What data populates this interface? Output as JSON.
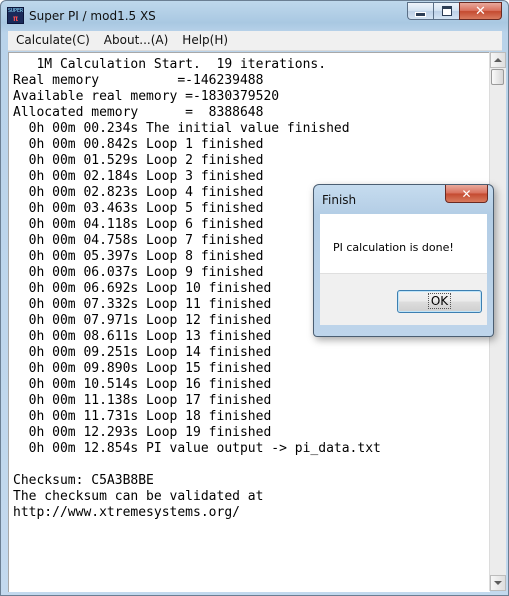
{
  "window": {
    "title": "Super PI / mod1.5 XS",
    "icon_text_top": "SUPER",
    "icon_text_bottom": "π"
  },
  "menu": [
    {
      "label": "Calculate(C)"
    },
    {
      "label": "About...(A)"
    },
    {
      "label": "Help(H)"
    }
  ],
  "console": {
    "lines": [
      "   1M Calculation Start.  19 iterations.",
      "Real memory          =-146239488",
      "Available real memory =-1830379520",
      "Allocated memory      =  8388648",
      "  0h 00m 00.234s The initial value finished",
      "  0h 00m 00.842s Loop 1 finished",
      "  0h 00m 01.529s Loop 2 finished",
      "  0h 00m 02.184s Loop 3 finished",
      "  0h 00m 02.823s Loop 4 finished",
      "  0h 00m 03.463s Loop 5 finished",
      "  0h 00m 04.118s Loop 6 finished",
      "  0h 00m 04.758s Loop 7 finished",
      "  0h 00m 05.397s Loop 8 finished",
      "  0h 00m 06.037s Loop 9 finished",
      "  0h 00m 06.692s Loop 10 finished",
      "  0h 00m 07.332s Loop 11 finished",
      "  0h 00m 07.971s Loop 12 finished",
      "  0h 00m 08.611s Loop 13 finished",
      "  0h 00m 09.251s Loop 14 finished",
      "  0h 00m 09.890s Loop 15 finished",
      "  0h 00m 10.514s Loop 16 finished",
      "  0h 00m 11.138s Loop 17 finished",
      "  0h 00m 11.731s Loop 18 finished",
      "  0h 00m 12.293s Loop 19 finished",
      "  0h 00m 12.854s PI value output -> pi_data.txt",
      "",
      "Checksum: C5A3B8BE",
      "The checksum can be validated at",
      "http://www.xtremesystems.org/"
    ]
  },
  "dialog": {
    "title": "Finish",
    "message": "PI calculation is done!",
    "ok_label": "OK",
    "close_label": "✕"
  },
  "caption_buttons": {
    "close_label": "✕"
  }
}
